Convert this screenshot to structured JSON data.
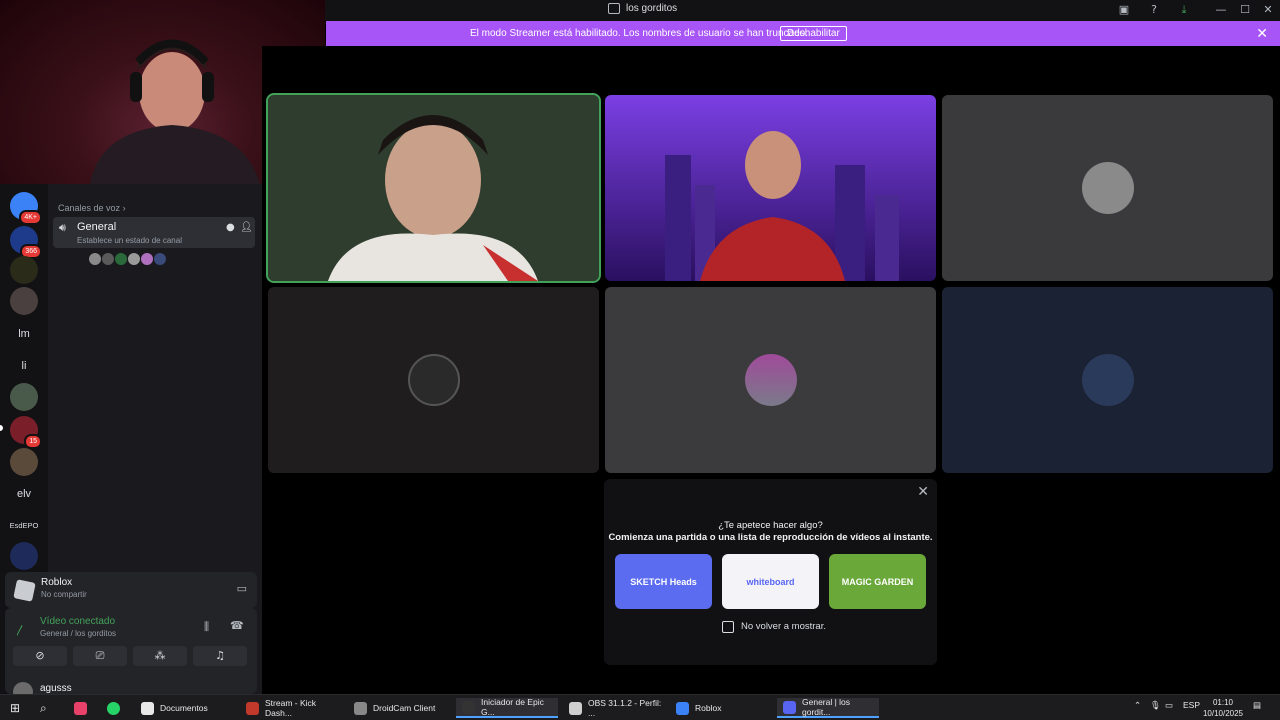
{
  "window": {
    "title": "los gorditos",
    "controls": {
      "minimize": "—",
      "maximize": "☐",
      "close": "✕"
    }
  },
  "banner": {
    "message": "El modo Streamer está habilitado. Los nombres de usuario se han truncado.",
    "button": "Deshabilitar",
    "close": "✕"
  },
  "servers": [
    {
      "label": "",
      "badge": "4K+",
      "color": "#3b82f6"
    },
    {
      "label": "",
      "badge": "366",
      "color": "#1e3a8a"
    },
    {
      "label": "",
      "badge": "",
      "color": "#2b2b1a"
    },
    {
      "label": "",
      "badge": "",
      "color": "#4b4040"
    },
    {
      "label": "lm",
      "badge": "",
      "color": "#121214"
    },
    {
      "label": "li",
      "badge": "",
      "color": "#121214"
    },
    {
      "label": "",
      "badge": "",
      "color": "#4a5a4a"
    },
    {
      "label": "",
      "badge": "15",
      "color": "#7a1f2a"
    },
    {
      "label": "",
      "badge": "",
      "color": "#5a4a3a"
    },
    {
      "label": "elv",
      "badge": "",
      "color": "#121214"
    },
    {
      "label": "EsdEPO",
      "badge": "",
      "color": "#121214"
    },
    {
      "label": "",
      "badge": "",
      "color": "#1e2a5a"
    }
  ],
  "sidebar": {
    "category": "Canales de voz",
    "channel": {
      "name": "General",
      "status": "Establece un estado de canal"
    },
    "members": [
      "#8a8a8a",
      "#5a5a5a",
      "#2a6a3a",
      "#9a9a9a",
      "#b070c0",
      "#3a4a7a"
    ]
  },
  "activity_panel": {
    "game": "Roblox",
    "state": "No compartir"
  },
  "voice_panel": {
    "status": "Vídeo conectado",
    "location": "General / los gorditos"
  },
  "user": {
    "name": "agusss"
  },
  "tiles": [
    {
      "bg": "#2a3a2a",
      "speaking": true
    },
    {
      "bg": "#4b1d7a",
      "speaking": false
    },
    {
      "bg": "#3a3a3c",
      "speaking": false
    },
    {
      "bg": "#1f1d1e",
      "speaking": false
    },
    {
      "bg": "#3b3b3d",
      "speaking": false
    },
    {
      "bg": "#1a2233",
      "speaking": false
    }
  ],
  "activity_card": {
    "close": "✕",
    "headline": "¿Te apetece hacer algo?",
    "subline": "Comienza una partida o una lista de reproducción de vídeos al instante.",
    "games": [
      {
        "name": "SKETCH Heads",
        "bg": "#5b6cf0"
      },
      {
        "name": "whiteboard",
        "bg": "#f4f4f8"
      },
      {
        "name": "MAGIC GARDEN",
        "bg": "#6aa83a"
      }
    ],
    "dont_show": "No volver a mostrar."
  },
  "taskbar": {
    "apps": [
      {
        "label": "Documentos",
        "color": "#e8e8e8",
        "active": false
      },
      {
        "label": "Stream - Kick Dash...",
        "color": "#c0392b",
        "active": false
      },
      {
        "label": "DroidCam Client",
        "color": "#888888",
        "active": false
      },
      {
        "label": "Iniciador de Epic G...",
        "color": "#333333",
        "active": true
      },
      {
        "label": "OBS 31.1.2 - Perfil: ...",
        "color": "#cfcfcf",
        "active": false
      },
      {
        "label": "Roblox",
        "color": "#3b82f6",
        "active": false
      },
      {
        "label": "General | los gordit...",
        "color": "#5865f2",
        "active": true
      }
    ],
    "lang": "ESP",
    "time": "01:10",
    "date": "10/10/2025"
  }
}
